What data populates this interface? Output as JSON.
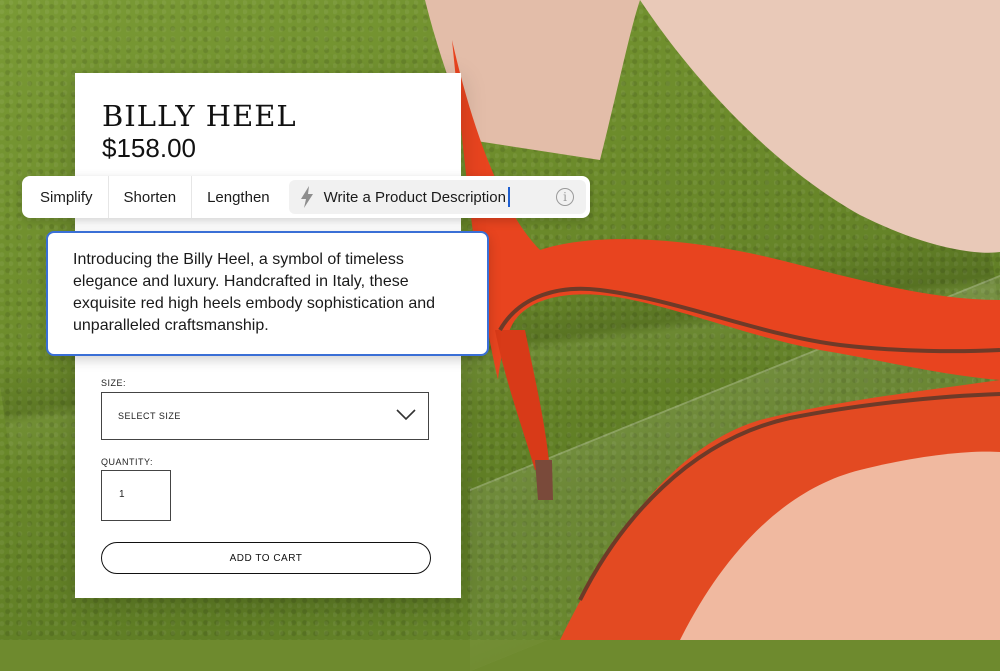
{
  "product": {
    "name": "BILLY HEEL",
    "price": "$158.00"
  },
  "toolbar": {
    "simplify": "Simplify",
    "shorten": "Shorten",
    "lengthen": "Lengthen",
    "prompt": "Write a Product Description",
    "prompt_icon": "lightning-bolt-icon",
    "info_icon": "info-icon"
  },
  "description": {
    "text": "Introducing the Billy Heel, a symbol of timeless elegance and luxury. Handcrafted in Italy, these exquisite red high heels embody sophistication and unparalleled craftsmanship."
  },
  "form": {
    "size_label": "SIZE:",
    "size_value": "SELECT SIZE",
    "quantity_label": "QUANTITY:",
    "quantity_value": "1",
    "add_to_cart": "ADD TO CART"
  },
  "colors": {
    "accent": "#3a6fd6",
    "shoe": "#e8441f",
    "background": "#6b8a2a"
  }
}
